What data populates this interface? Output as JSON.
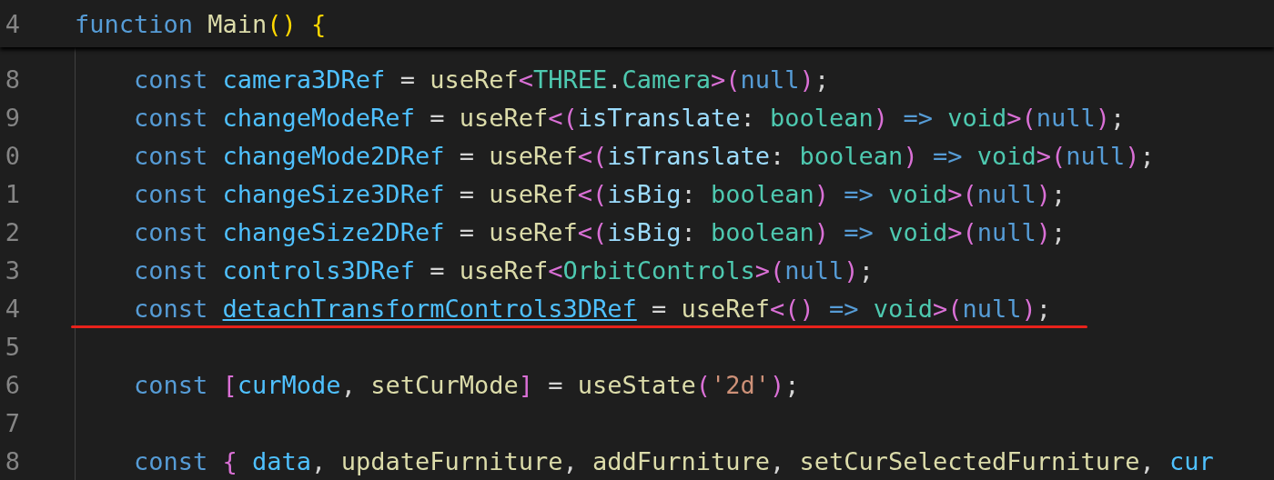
{
  "sticky_header": {
    "line_number": "4",
    "tokens": [
      {
        "text": "function ",
        "kind": "keyword"
      },
      {
        "text": "Main",
        "kind": "function"
      },
      {
        "text": "() {",
        "kind": "bracket1"
      }
    ]
  },
  "lines": [
    {
      "line_number": "8",
      "annotated": false,
      "tokens": [
        {
          "text": "    const ",
          "kind": "keyword"
        },
        {
          "text": "camera3DRef",
          "kind": "constant"
        },
        {
          "text": " = ",
          "kind": "plain"
        },
        {
          "text": "useRef",
          "kind": "function"
        },
        {
          "text": "<",
          "kind": "bracket2"
        },
        {
          "text": "THREE",
          "kind": "type"
        },
        {
          "text": ".",
          "kind": "plain"
        },
        {
          "text": "Camera",
          "kind": "type"
        },
        {
          "text": ">(",
          "kind": "bracket2"
        },
        {
          "text": "null",
          "kind": "keyword"
        },
        {
          "text": ")",
          "kind": "bracket2"
        },
        {
          "text": ";",
          "kind": "plain"
        }
      ]
    },
    {
      "line_number": "9",
      "annotated": false,
      "tokens": [
        {
          "text": "    const ",
          "kind": "keyword"
        },
        {
          "text": "changeModeRef",
          "kind": "constant"
        },
        {
          "text": " = ",
          "kind": "plain"
        },
        {
          "text": "useRef",
          "kind": "function"
        },
        {
          "text": "<(",
          "kind": "bracket2"
        },
        {
          "text": "isTranslate",
          "kind": "param"
        },
        {
          "text": ": ",
          "kind": "plain"
        },
        {
          "text": "boolean",
          "kind": "type"
        },
        {
          "text": ") ",
          "kind": "bracket2"
        },
        {
          "text": "=> ",
          "kind": "keyword"
        },
        {
          "text": "void",
          "kind": "type"
        },
        {
          "text": ">(",
          "kind": "bracket2"
        },
        {
          "text": "null",
          "kind": "keyword"
        },
        {
          "text": ")",
          "kind": "bracket2"
        },
        {
          "text": ";",
          "kind": "plain"
        }
      ]
    },
    {
      "line_number": "0",
      "annotated": false,
      "tokens": [
        {
          "text": "    const ",
          "kind": "keyword"
        },
        {
          "text": "changeMode2DRef",
          "kind": "constant"
        },
        {
          "text": " = ",
          "kind": "plain"
        },
        {
          "text": "useRef",
          "kind": "function"
        },
        {
          "text": "<(",
          "kind": "bracket2"
        },
        {
          "text": "isTranslate",
          "kind": "param"
        },
        {
          "text": ": ",
          "kind": "plain"
        },
        {
          "text": "boolean",
          "kind": "type"
        },
        {
          "text": ") ",
          "kind": "bracket2"
        },
        {
          "text": "=> ",
          "kind": "keyword"
        },
        {
          "text": "void",
          "kind": "type"
        },
        {
          "text": ">(",
          "kind": "bracket2"
        },
        {
          "text": "null",
          "kind": "keyword"
        },
        {
          "text": ")",
          "kind": "bracket2"
        },
        {
          "text": ";",
          "kind": "plain"
        }
      ]
    },
    {
      "line_number": "1",
      "annotated": false,
      "tokens": [
        {
          "text": "    const ",
          "kind": "keyword"
        },
        {
          "text": "changeSize3DRef",
          "kind": "constant"
        },
        {
          "text": " = ",
          "kind": "plain"
        },
        {
          "text": "useRef",
          "kind": "function"
        },
        {
          "text": "<(",
          "kind": "bracket2"
        },
        {
          "text": "isBig",
          "kind": "param"
        },
        {
          "text": ": ",
          "kind": "plain"
        },
        {
          "text": "boolean",
          "kind": "type"
        },
        {
          "text": ") ",
          "kind": "bracket2"
        },
        {
          "text": "=> ",
          "kind": "keyword"
        },
        {
          "text": "void",
          "kind": "type"
        },
        {
          "text": ">(",
          "kind": "bracket2"
        },
        {
          "text": "null",
          "kind": "keyword"
        },
        {
          "text": ")",
          "kind": "bracket2"
        },
        {
          "text": ";",
          "kind": "plain"
        }
      ]
    },
    {
      "line_number": "2",
      "annotated": false,
      "tokens": [
        {
          "text": "    const ",
          "kind": "keyword"
        },
        {
          "text": "changeSize2DRef",
          "kind": "constant"
        },
        {
          "text": " = ",
          "kind": "plain"
        },
        {
          "text": "useRef",
          "kind": "function"
        },
        {
          "text": "<(",
          "kind": "bracket2"
        },
        {
          "text": "isBig",
          "kind": "param"
        },
        {
          "text": ": ",
          "kind": "plain"
        },
        {
          "text": "boolean",
          "kind": "type"
        },
        {
          "text": ") ",
          "kind": "bracket2"
        },
        {
          "text": "=> ",
          "kind": "keyword"
        },
        {
          "text": "void",
          "kind": "type"
        },
        {
          "text": ">(",
          "kind": "bracket2"
        },
        {
          "text": "null",
          "kind": "keyword"
        },
        {
          "text": ")",
          "kind": "bracket2"
        },
        {
          "text": ";",
          "kind": "plain"
        }
      ]
    },
    {
      "line_number": "3",
      "annotated": false,
      "tokens": [
        {
          "text": "    const ",
          "kind": "keyword"
        },
        {
          "text": "controls3DRef",
          "kind": "constant"
        },
        {
          "text": " = ",
          "kind": "plain"
        },
        {
          "text": "useRef",
          "kind": "function"
        },
        {
          "text": "<",
          "kind": "bracket2"
        },
        {
          "text": "OrbitControls",
          "kind": "type"
        },
        {
          "text": ">(",
          "kind": "bracket2"
        },
        {
          "text": "null",
          "kind": "keyword"
        },
        {
          "text": ")",
          "kind": "bracket2"
        },
        {
          "text": ";",
          "kind": "plain"
        }
      ]
    },
    {
      "line_number": "4",
      "annotated": true,
      "tokens": [
        {
          "text": "    const ",
          "kind": "keyword"
        },
        {
          "text": "detachTransformControls3DRef",
          "kind": "link"
        },
        {
          "text": " = ",
          "kind": "plain"
        },
        {
          "text": "useRef",
          "kind": "function"
        },
        {
          "text": "<() ",
          "kind": "bracket2"
        },
        {
          "text": "=> ",
          "kind": "keyword"
        },
        {
          "text": "void",
          "kind": "type"
        },
        {
          "text": ">(",
          "kind": "bracket2"
        },
        {
          "text": "null",
          "kind": "keyword"
        },
        {
          "text": ")",
          "kind": "bracket2"
        },
        {
          "text": ";",
          "kind": "plain"
        }
      ]
    },
    {
      "line_number": "5",
      "annotated": false
    },
    {
      "line_number": "6",
      "annotated": false,
      "tokens": [
        {
          "text": "    const ",
          "kind": "keyword"
        },
        {
          "text": "[",
          "kind": "bracket2"
        },
        {
          "text": "curMode",
          "kind": "constant"
        },
        {
          "text": ", ",
          "kind": "plain"
        },
        {
          "text": "setCurMode",
          "kind": "function"
        },
        {
          "text": "]",
          "kind": "bracket2"
        },
        {
          "text": " = ",
          "kind": "plain"
        },
        {
          "text": "useState",
          "kind": "function"
        },
        {
          "text": "(",
          "kind": "bracket2"
        },
        {
          "text": "'2d'",
          "kind": "string"
        },
        {
          "text": ")",
          "kind": "bracket2"
        },
        {
          "text": ";",
          "kind": "plain"
        }
      ]
    },
    {
      "line_number": "7",
      "annotated": false
    },
    {
      "line_number": "8",
      "annotated": false,
      "tokens": [
        {
          "text": "    const ",
          "kind": "keyword"
        },
        {
          "text": "{",
          "kind": "bracket2"
        },
        {
          "text": " data",
          "kind": "constant"
        },
        {
          "text": ", ",
          "kind": "plain"
        },
        {
          "text": "updateFurniture",
          "kind": "function"
        },
        {
          "text": ", ",
          "kind": "plain"
        },
        {
          "text": "addFurniture",
          "kind": "function"
        },
        {
          "text": ", ",
          "kind": "plain"
        },
        {
          "text": "setCurSelectedFurniture",
          "kind": "function"
        },
        {
          "text": ", ",
          "kind": "plain"
        },
        {
          "text": "cur",
          "kind": "constant"
        }
      ]
    }
  ]
}
